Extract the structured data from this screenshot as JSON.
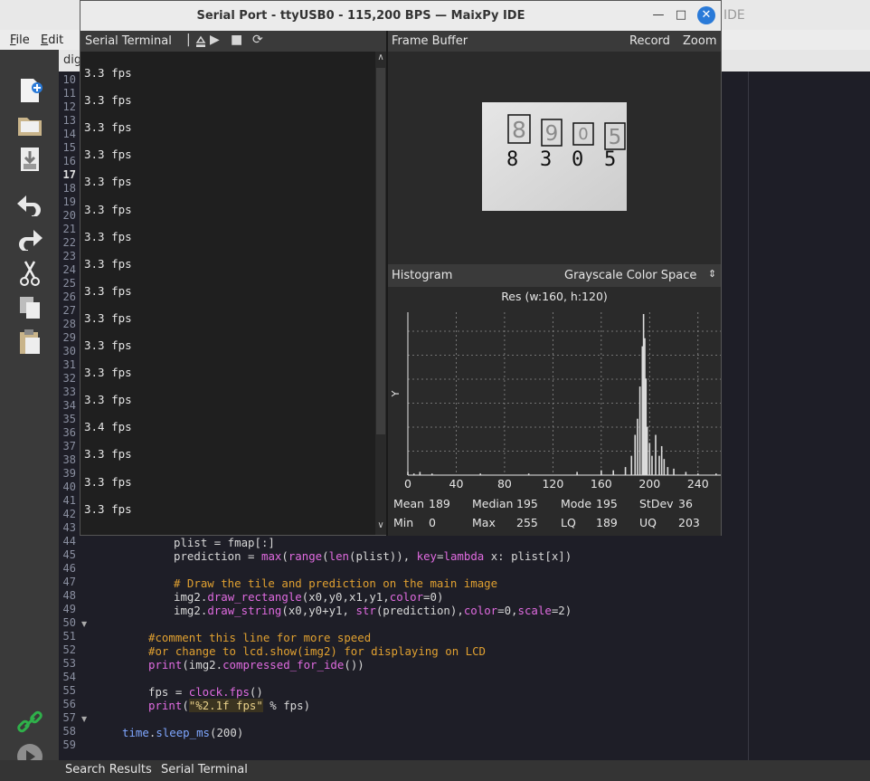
{
  "ide": {
    "title_fragment": "IDE",
    "menu": [
      {
        "label": "File",
        "underline": "F",
        "rest": "ile"
      },
      {
        "label": "Edit",
        "underline": "E",
        "rest": "dit"
      }
    ],
    "tab_label": "dig",
    "bottom_tabs": [
      "Search Results",
      "Serial Terminal"
    ],
    "toolbar_icons": [
      "new-file-icon",
      "open-file-icon",
      "save-file-icon",
      "undo-icon",
      "redo-icon",
      "cut-icon",
      "copy-icon",
      "paste-icon",
      "connect-icon",
      "run-icon"
    ]
  },
  "editor": {
    "line_numbers": [
      "10",
      "11",
      "12",
      "13",
      "14",
      "15",
      "16",
      "17",
      "18",
      "19",
      "20",
      "21",
      "22",
      "23",
      "24",
      "25",
      "26",
      "27",
      "28",
      "29",
      "30",
      "31",
      "32",
      "33",
      "34",
      "35",
      "36",
      "37",
      "38",
      "39",
      "40",
      "41",
      "42",
      "43",
      "44",
      "45",
      "46",
      "47",
      "48",
      "49",
      "50",
      "51",
      "52",
      "53",
      "54",
      "55",
      "56",
      "57",
      "58",
      "59"
    ],
    "current_line": "17"
  },
  "dialog": {
    "title": "Serial Port - ttyUSB0 - 115,200 BPS — MaixPy IDE",
    "terminal_title": "Serial Terminal",
    "fps_lines": [
      "3.3 fps",
      "3.3 fps",
      "3.3 fps",
      "3.3 fps",
      "3.3 fps",
      "3.3 fps",
      "3.3 fps",
      "3.3 fps",
      "3.3 fps",
      "3.3 fps",
      "3.3 fps",
      "3.3 fps",
      "3.3 fps",
      "3.4 fps",
      "3.3 fps",
      "3.3 fps",
      "3.3 fps"
    ],
    "frame_buffer": {
      "title": "Frame Buffer",
      "record_label": "Record",
      "zoom_label": "Zoom",
      "detected_digits": [
        "8",
        "3",
        "0",
        "5"
      ],
      "written_digits": [
        "8",
        "9",
        "0",
        "5"
      ]
    },
    "histogram": {
      "title": "Histogram",
      "color_space": "Grayscale Color Space",
      "resolution": "Res (w:160, h:120)",
      "ylabel": "Y",
      "x_ticks": [
        "0",
        "40",
        "80",
        "120",
        "160",
        "200",
        "240"
      ],
      "stats": {
        "mean_label": "Mean",
        "mean": "189",
        "median_label": "Median",
        "median": "195",
        "mode_label": "Mode",
        "mode": "195",
        "stdev_label": "StDev",
        "stdev": "36",
        "min_label": "Min",
        "min": "0",
        "max_label": "Max",
        "max": "255",
        "lq_label": "LQ",
        "lq": "189",
        "uq_label": "UQ",
        "uq": "203"
      }
    }
  },
  "chart_data": {
    "type": "bar",
    "title": "Res (w:160, h:120)",
    "xlabel": "",
    "ylabel": "Y",
    "xlim": [
      0,
      255
    ],
    "grid": true,
    "x": [
      0,
      5,
      10,
      20,
      60,
      100,
      140,
      160,
      170,
      180,
      185,
      188,
      190,
      192,
      194,
      195,
      196,
      197,
      198,
      200,
      202,
      205,
      208,
      210,
      212,
      215,
      220,
      230,
      240,
      255
    ],
    "values": [
      0.02,
      0.01,
      0.02,
      0.01,
      0.01,
      0.01,
      0.02,
      0.03,
      0.03,
      0.05,
      0.12,
      0.25,
      0.35,
      0.55,
      0.8,
      1.0,
      0.85,
      0.6,
      0.3,
      0.2,
      0.12,
      0.25,
      0.12,
      0.18,
      0.1,
      0.05,
      0.04,
      0.02,
      0.01,
      0.01
    ]
  }
}
